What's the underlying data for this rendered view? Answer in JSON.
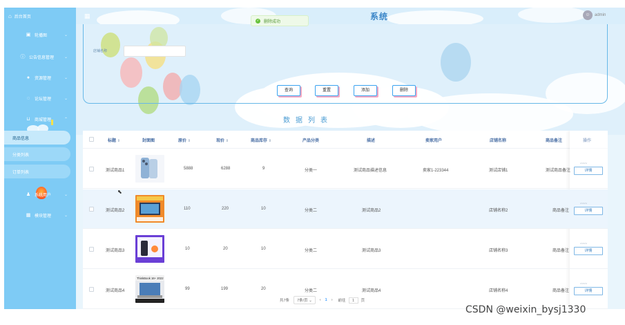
{
  "sidebar": {
    "home": "后台首页",
    "menus": [
      {
        "label": "轮播图",
        "icon": "image-icon"
      },
      {
        "label": "公告信息管理",
        "icon": "info-icon"
      },
      {
        "label": "资源管理",
        "icon": "location-icon"
      },
      {
        "label": "论坛管理",
        "icon": "chat-icon"
      },
      {
        "label": "商城管理",
        "icon": "cart-icon"
      },
      {
        "label": "系统用户",
        "icon": "user-icon"
      },
      {
        "label": "模块管理",
        "icon": "grid-icon"
      }
    ],
    "submenu": [
      {
        "label": "商品信息",
        "active": true
      },
      {
        "label": "分类列表",
        "active": false
      },
      {
        "label": "订单列表",
        "active": false
      }
    ]
  },
  "header": {
    "title": "系统",
    "user": "admin"
  },
  "toast": {
    "message": "删除成功"
  },
  "search": {
    "label": "店铺名称",
    "buttons": [
      "查询",
      "重置",
      "添加",
      "删除"
    ]
  },
  "list_title": "数据列表",
  "table": {
    "columns": [
      "标题",
      "封面图",
      "原价",
      "现价",
      "商品库存",
      "产品分类",
      "描述",
      "卖家用户",
      "店铺名称",
      "商品备注",
      "操作"
    ],
    "rows": [
      {
        "title": "测试商品1",
        "thumb": "phone-blue-image",
        "price": "5888",
        "sale": "6288",
        "stock": "9",
        "cat": "分类一",
        "desc": "测试商品描述信息",
        "seller": "卖家1-223344",
        "shop": "测试店铺1",
        "note": "测试商品备注"
      },
      {
        "title": "测试商品2",
        "thumb": "monitor-image",
        "price": "110",
        "sale": "220",
        "stock": "10",
        "cat": "分类二",
        "desc": "测试商品2",
        "seller": "",
        "shop": "店铺名称2",
        "note": "商品备注"
      },
      {
        "title": "测试商品3",
        "thumb": "phone-purple-image",
        "price": "10",
        "sale": "20",
        "stock": "10",
        "cat": "分类二",
        "desc": "测试商品3",
        "seller": "",
        "shop": "店铺名称3",
        "note": "商品备注"
      },
      {
        "title": "测试商品4",
        "thumb": "laptop-image",
        "price": "99",
        "sale": "199",
        "stock": "20",
        "cat": "分类二",
        "desc": "测试商品4",
        "seller": "",
        "shop": "店铺名称4",
        "note": "商品备注"
      }
    ],
    "detail_label": "详情",
    "thumb_banner": "ThinkBook 16+ 2022"
  },
  "pager": {
    "total": "共7条",
    "size": "7条/页",
    "current": "1",
    "goto": "前往",
    "goto_value": "1",
    "page_unit": "页"
  },
  "watermark": "CSDN @weixin_bysj1330",
  "colors": {
    "sidebar": "#7ecbf5",
    "accent": "#409eff",
    "success": "#67c23a"
  }
}
